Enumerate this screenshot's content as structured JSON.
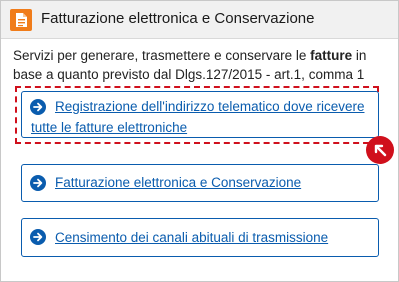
{
  "panel": {
    "icon": "document-icon",
    "title": "Fatturazione elettronica e Conservazione",
    "intro_before": "Servizi per generare, trasmettere e conservare le ",
    "intro_bold": "fatture",
    "intro_after": " in base a quanto previsto dal Dlgs.127/2015 - art.1, comma 1"
  },
  "services": [
    {
      "label": "Registrazione dell'indirizzo telematico dove ricevere tutte le fatture elettroniche",
      "icon": "arrow-right-circle-icon"
    },
    {
      "label": "Fatturazione elettronica e Conservazione",
      "icon": "arrow-right-circle-icon"
    },
    {
      "label": "Censimento dei canali abituali di trasmissione",
      "icon": "arrow-right-circle-icon"
    }
  ],
  "cursor_indicator": {
    "icon": "pointer-arrow-icon"
  },
  "colors": {
    "accent_orange": "#f07c1a",
    "link_blue": "#0a5cae",
    "focus_red": "#d0101c",
    "header_bg": "#f1f1f1"
  }
}
